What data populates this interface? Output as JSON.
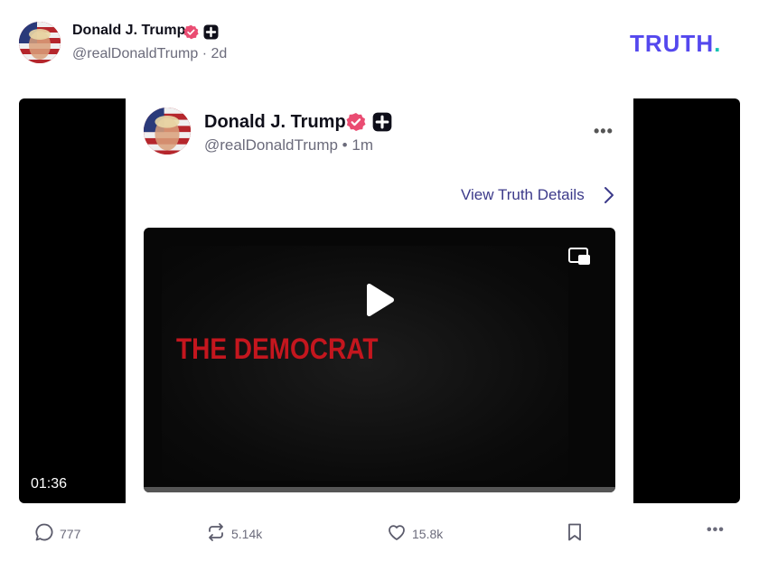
{
  "author": {
    "name": "Donald J. Trump",
    "handle": "@realDonaldTrump",
    "meta": "@realDonaldTrump · 2d"
  },
  "brand": {
    "logo_main": "TRUTH",
    "logo_dot": ".",
    "primary": "#5448ee",
    "accent": "#17c3b2"
  },
  "embedded": {
    "name": "Donald J. Trump",
    "meta": "@realDonaldTrump • 1m",
    "more_label": "•••",
    "details_label": "View Truth Details",
    "video_text": "THE DEMOCRAT"
  },
  "video": {
    "duration": "01:36"
  },
  "actions": {
    "replies": "777",
    "retruths": "5.14k",
    "likes": "15.8k",
    "more_label": "•••"
  },
  "icons": [
    "verified-badge-icon",
    "plus-badge-icon",
    "more-icon",
    "chevron-right-icon",
    "play-icon",
    "pip-icon",
    "reply-icon",
    "retruth-icon",
    "like-icon",
    "bookmark-icon"
  ]
}
